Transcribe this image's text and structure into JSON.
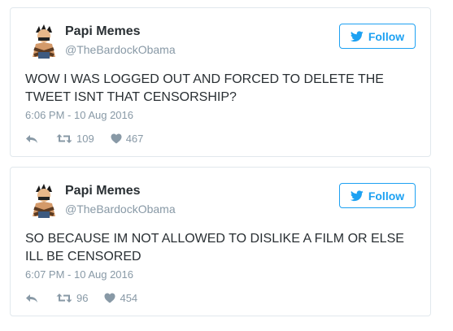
{
  "tweets": [
    {
      "name": "Papi Memes",
      "handle": "@TheBardockObama",
      "follow_label": "Follow",
      "text": "WOW I WAS LOGGED OUT AND FORCED TO DELETE THE TWEET ISNT THAT CENSORSHIP?",
      "timestamp": "6:06 PM - 10 Aug 2016",
      "retweets": "109",
      "likes": "467"
    },
    {
      "name": "Papi Memes",
      "handle": "@TheBardockObama",
      "follow_label": "Follow",
      "text": "SO BECAUSE IM NOT ALLOWED TO DISLIKE A FILM OR ELSE ILL BE CENSORED",
      "timestamp": "6:07 PM - 10 Aug 2016",
      "retweets": "96",
      "likes": "454"
    }
  ],
  "icons": {
    "reply": "reply-icon",
    "retweet": "retweet-icon",
    "like": "heart-icon",
    "follow": "twitter-bird-icon"
  },
  "colors": {
    "accent": "#1da1f2",
    "muted": "#8899a6",
    "text": "#292f33",
    "border": "#e1e8ed"
  }
}
